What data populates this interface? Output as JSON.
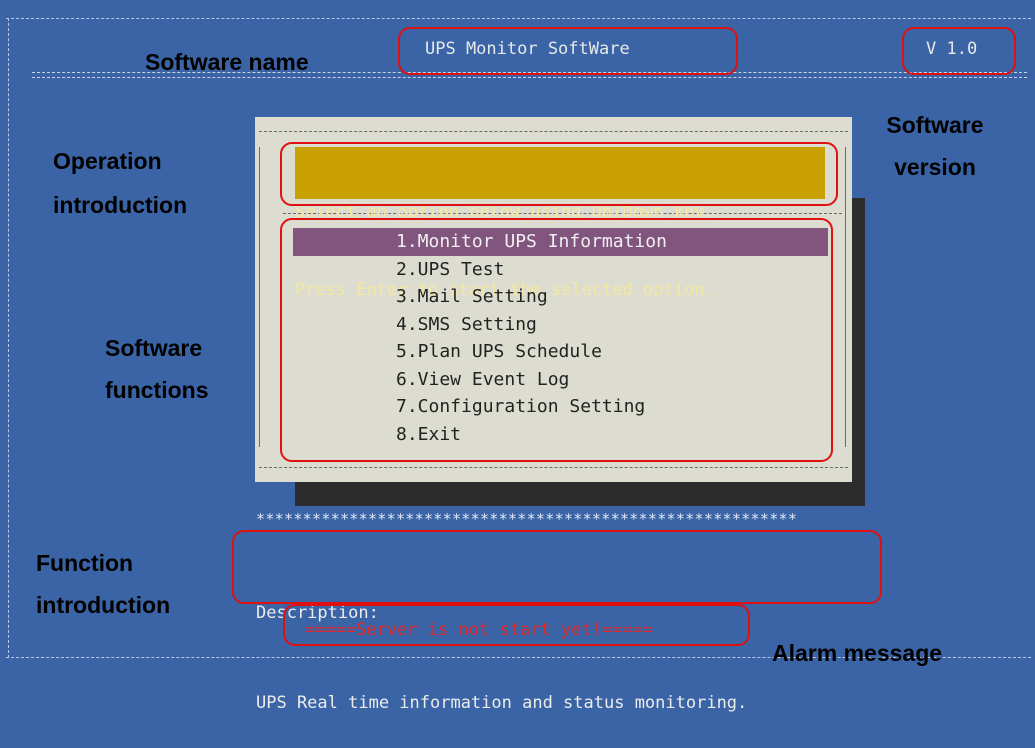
{
  "header": {
    "software_name": "UPS Monitor SoftWare",
    "version": "V 1.0"
  },
  "dialog": {
    "intro_line1": "Select an option below using Up/Down key.",
    "intro_line2": "Press Enter to start the selected option.",
    "menu": [
      {
        "label": "1.Monitor UPS Information",
        "selected": true
      },
      {
        "label": "2.UPS Test",
        "selected": false
      },
      {
        "label": "3.Mail Setting",
        "selected": false
      },
      {
        "label": "4.SMS Setting",
        "selected": false
      },
      {
        "label": "5.Plan UPS Schedule",
        "selected": false
      },
      {
        "label": "6.View Event Log",
        "selected": false
      },
      {
        "label": "7.Configuration Setting",
        "selected": false
      },
      {
        "label": "8.Exit",
        "selected": false
      }
    ]
  },
  "separator": "**********************************************************",
  "description": {
    "heading": "Description:",
    "text": "UPS Real time information and status monitoring."
  },
  "alarm": "=====Server is not start yet!=====",
  "annotations": {
    "software_name": "Software name",
    "software_version_1": "Software",
    "software_version_2": "version",
    "operation_intro_1": "Operation",
    "operation_intro_2": "introduction",
    "software_functions_1": "Software",
    "software_functions_2": "functions",
    "function_intro_1": "Function",
    "function_intro_2": "introduction",
    "alarm_message": "Alarm message"
  },
  "colors": {
    "background": "#3a64a6",
    "dialog": "#dcdcd0",
    "highlight": "#82557e",
    "intro_bg": "#c8a000",
    "annotation_box": "#e01010",
    "alarm_text": "#e02828"
  }
}
